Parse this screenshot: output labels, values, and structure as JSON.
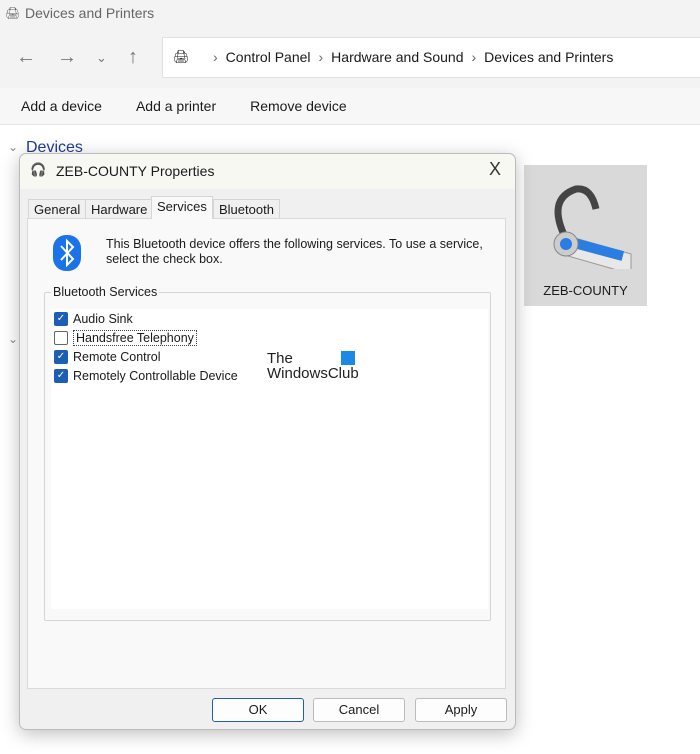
{
  "window": {
    "title": "Devices and Printers"
  },
  "breadcrumb": [
    "Control Panel",
    "Hardware and Sound",
    "Devices and Printers"
  ],
  "toolbar": {
    "add_device": "Add a device",
    "add_printer": "Add a printer",
    "remove_device": "Remove device"
  },
  "section": {
    "devices": "Devices"
  },
  "device": {
    "name": "ZEB-COUNTY"
  },
  "dialog": {
    "title": "ZEB-COUNTY Properties",
    "close": "X",
    "tabs": [
      "General",
      "Hardware",
      "Services",
      "Bluetooth"
    ],
    "active_tab": "Services",
    "description": "This Bluetooth device offers the following services. To use a service, select the check box.",
    "group_label": "Bluetooth Services",
    "services": [
      {
        "label": "Audio Sink",
        "checked": true
      },
      {
        "label": "Handsfree Telephony",
        "checked": false
      },
      {
        "label": "Remote Control",
        "checked": true
      },
      {
        "label": "Remotely Controllable Device",
        "checked": true
      }
    ],
    "ok": "OK",
    "cancel": "Cancel",
    "apply": "Apply"
  },
  "watermark": {
    "line1": "The",
    "line2": "WindowsClub"
  },
  "colors": {
    "accent": "#1e5eb5",
    "bluetooth": "#1a73e8"
  }
}
